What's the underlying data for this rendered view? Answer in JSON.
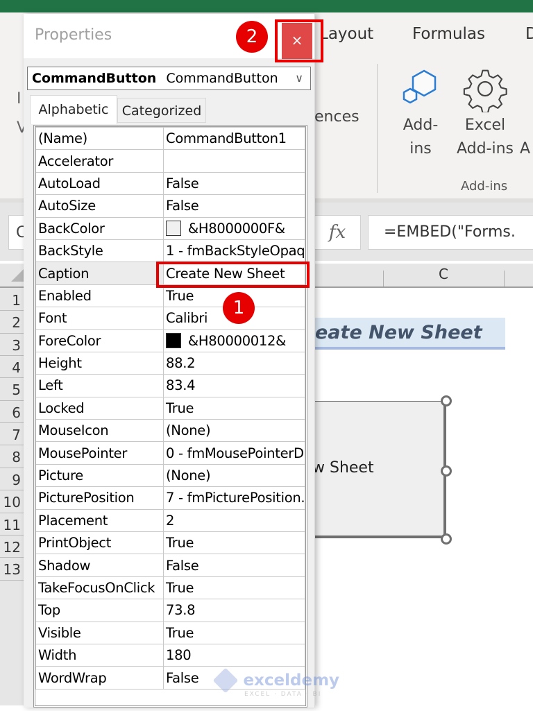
{
  "excel": {
    "ribbon_tabs": [
      {
        "label": "Layout"
      },
      {
        "label": "Formulas"
      },
      {
        "label": "D"
      }
    ],
    "ribbon_fragments": {
      "references_partial": "ences",
      "left_partial_1": "I",
      "left_partial_2": "V"
    },
    "addins_group": {
      "addins_button": {
        "line1": "Add-",
        "line2": "ins",
        "icon": "addins-hexagon-icon"
      },
      "excel_addins_button": {
        "line1": "Excel",
        "line2": "Add-ins",
        "icon": "gear-icon"
      },
      "partial_button_label": "A",
      "group_label": "Add-ins"
    },
    "name_box_partial": "C",
    "fx_label": "fx",
    "formula_value": "=EMBED(\"Forms.",
    "column_headers": [
      "C"
    ],
    "row_numbers": [
      "1",
      "2",
      "3",
      "4",
      "5",
      "6",
      "7",
      "8",
      "9",
      "10",
      "11",
      "12",
      "13"
    ],
    "cell_title_partial": "eate New Sheet",
    "command_button_caption_partial": "w Sheet"
  },
  "properties_window": {
    "title": "Properties",
    "close_label": "×",
    "object_combo": {
      "name": "CommandButton",
      "type": "CommandButton",
      "chevron": "∨"
    },
    "tabs": [
      {
        "label": "Alphabetic",
        "active": true
      },
      {
        "label": "Categorized",
        "active": false
      }
    ],
    "properties": [
      {
        "name": "(Name)",
        "value": "CommandButton1"
      },
      {
        "name": "Accelerator",
        "value": ""
      },
      {
        "name": "AutoLoad",
        "value": "False"
      },
      {
        "name": "AutoSize",
        "value": "False"
      },
      {
        "name": "BackColor",
        "value": "&H8000000F&",
        "swatch": "#f0f0f0"
      },
      {
        "name": "BackStyle",
        "value": "1 - fmBackStyleOpaq"
      },
      {
        "name": "Caption",
        "value": "Create New Sheet"
      },
      {
        "name": "Enabled",
        "value": "True"
      },
      {
        "name": "Font",
        "value": "Calibri"
      },
      {
        "name": "ForeColor",
        "value": "&H80000012&",
        "swatch": "#000000"
      },
      {
        "name": "Height",
        "value": "88.2"
      },
      {
        "name": "Left",
        "value": "83.4"
      },
      {
        "name": "Locked",
        "value": "True"
      },
      {
        "name": "MouseIcon",
        "value": "(None)"
      },
      {
        "name": "MousePointer",
        "value": "0 - fmMousePointerD"
      },
      {
        "name": "Picture",
        "value": "(None)"
      },
      {
        "name": "PicturePosition",
        "value": "7 - fmPicturePosition."
      },
      {
        "name": "Placement",
        "value": "2"
      },
      {
        "name": "PrintObject",
        "value": "True"
      },
      {
        "name": "Shadow",
        "value": "False"
      },
      {
        "name": "TakeFocusOnClick",
        "value": "True"
      },
      {
        "name": "Top",
        "value": "73.8"
      },
      {
        "name": "Visible",
        "value": "True"
      },
      {
        "name": "Width",
        "value": "180"
      },
      {
        "name": "WordWrap",
        "value": "False"
      }
    ]
  },
  "annotations": {
    "step1": "1",
    "step2": "2",
    "highlight_color": "#e60000"
  },
  "watermark": {
    "name": "exceldemy",
    "tagline": "EXCEL · DATA · BI"
  }
}
